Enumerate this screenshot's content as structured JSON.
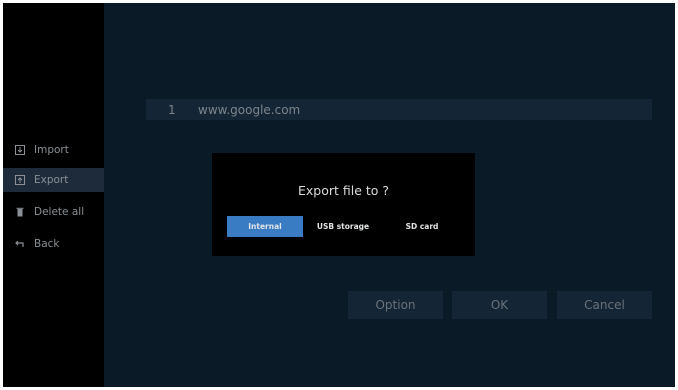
{
  "sidebar": {
    "items": [
      {
        "label": "Import",
        "icon": "import-icon",
        "active": false
      },
      {
        "label": "Export",
        "icon": "export-icon",
        "active": true
      },
      {
        "label": "Delete all",
        "icon": "trash-icon",
        "active": false
      },
      {
        "label": "Back",
        "icon": "back-arrow-icon",
        "active": false
      }
    ]
  },
  "list": {
    "rows": [
      {
        "index": "1",
        "url": "www.google.com"
      }
    ]
  },
  "buttons": {
    "option": "Option",
    "ok": "OK",
    "cancel": "Cancel"
  },
  "dialog": {
    "title": "Export file to ?",
    "options": [
      {
        "label": "Internal",
        "selected": true
      },
      {
        "label": "USB storage",
        "selected": false
      },
      {
        "label": "SD card",
        "selected": false
      }
    ]
  },
  "colors": {
    "background": "#0b1a27",
    "sidebar": "#000000",
    "active_item": "#1d2b3a",
    "selected_option": "#3a7cc4"
  }
}
